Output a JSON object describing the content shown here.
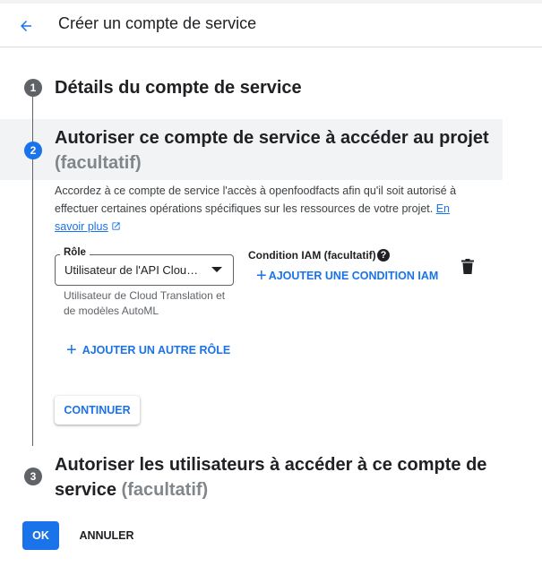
{
  "header": {
    "back_icon": "arrow-back-icon",
    "title": "Créer un compte de service"
  },
  "steps": [
    {
      "number": "1",
      "title": "Détails du compte de service",
      "optional": "",
      "state": "done"
    },
    {
      "number": "2",
      "title": "Autoriser ce compte de service à accéder au projet",
      "optional": "(facultatif)",
      "state": "active"
    },
    {
      "number": "3",
      "title": "Autoriser les utilisateurs à accéder à ce compte de service",
      "optional": "(facultatif)",
      "state": "pending"
    }
  ],
  "step2": {
    "description": "Accordez à ce compte de service l'accès à openfoodfacts afin qu'il soit autorisé à effectuer certaines opérations spécifiques sur les ressources de votre projet.",
    "learn_more": "En savoir plus",
    "role": {
      "label": "Rôle",
      "value": "Utilisateur de l'API Cloud Translation",
      "hint": "Utilisateur de Cloud Translation et de modèles AutoML"
    },
    "condition": {
      "label": "Condition IAM (facultatif)",
      "help_icon": "help-circle-icon",
      "add_label": "AJOUTER UNE CONDITION IAM"
    },
    "delete_icon": "trash-icon",
    "add_role_label": "AJOUTER UN AUTRE RÔLE",
    "continue_label": "CONTINUER"
  },
  "footer": {
    "ok_label": "OK",
    "cancel_label": "ANNULER"
  },
  "colors": {
    "accent": "#1a73e8",
    "active_band": "#f1f3f4",
    "done_step": "#5f6368",
    "optional_text": "#80868b"
  }
}
